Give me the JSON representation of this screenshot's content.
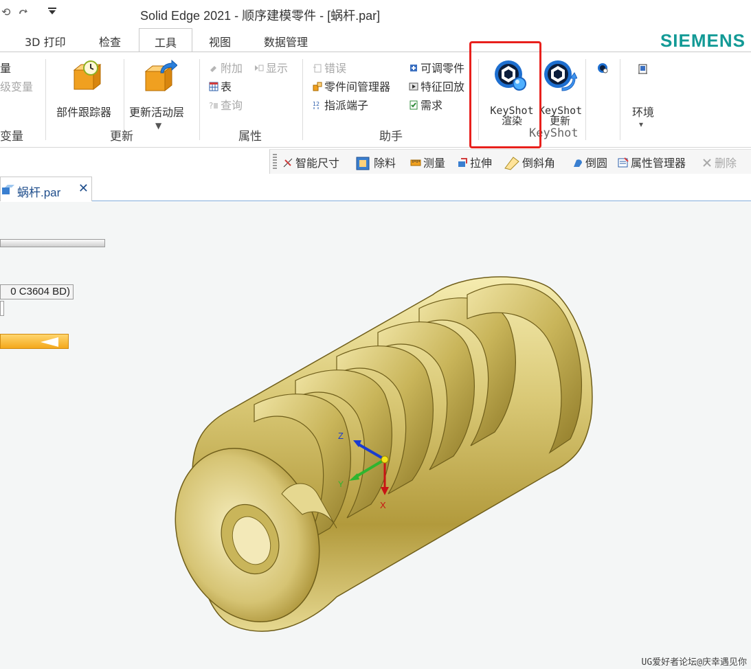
{
  "title_bar": {
    "title": "Solid Edge 2021 - 顺序建模零件 - [蜗杆.par]"
  },
  "tabs": [
    {
      "label": "3D 打印",
      "active": false
    },
    {
      "label": "检查",
      "active": false
    },
    {
      "label": "工具",
      "active": true
    },
    {
      "label": "视图",
      "active": false
    },
    {
      "label": "数据管理",
      "active": false
    }
  ],
  "brand": "SIEMENS",
  "ribbon": {
    "variables_group": {
      "items": [
        "量",
        "级变量"
      ],
      "label": "变量"
    },
    "update_group": {
      "label": "更新",
      "part_tracker": "部件跟踪器",
      "update_active_layer": "更新活动层"
    },
    "properties_group": {
      "label": "属性",
      "attach": "附加",
      "show": "显示",
      "table": "表",
      "query": "查询"
    },
    "assistant_group": {
      "label": "助手",
      "errors": "错误",
      "interpart_manager": "零件间管理器",
      "assign_terminals": "指派端子",
      "adjustable_part": "可调零件",
      "feature_playback": "特征回放",
      "requirements": "需求"
    },
    "keyshot_group": {
      "label": "KeyShot",
      "render_line1": "KeyShot",
      "render_line2": "渲染",
      "update_line1": "KeyShot",
      "update_line2": "更新"
    },
    "environment": {
      "label": "环境",
      "dropdown": "▾"
    }
  },
  "command_bar": {
    "smart_dimension": "智能尺寸",
    "thin_wall": "除料",
    "measure": "测量",
    "extrude": "拉伸",
    "chamfer": "倒斜角",
    "round": "倒圆",
    "property_manager": "属性管理器",
    "delete": "删除"
  },
  "document_tab": {
    "name": "蜗杆.par",
    "close_glyph": "✕"
  },
  "viewport": {
    "material_text": "0 C3604 BD)",
    "triad": {
      "z": "Z",
      "y": "Y",
      "x": "X"
    },
    "model_description": "worm gear"
  },
  "watermark": "UG爱好者论坛@庆幸遇见你",
  "colors": {
    "brand": "#139a96",
    "highlight": "#e8201c",
    "model_gold": "#d8c878",
    "axis_z": "#1a3ccf",
    "axis_y": "#2fb52f",
    "axis_x": "#c81414"
  }
}
